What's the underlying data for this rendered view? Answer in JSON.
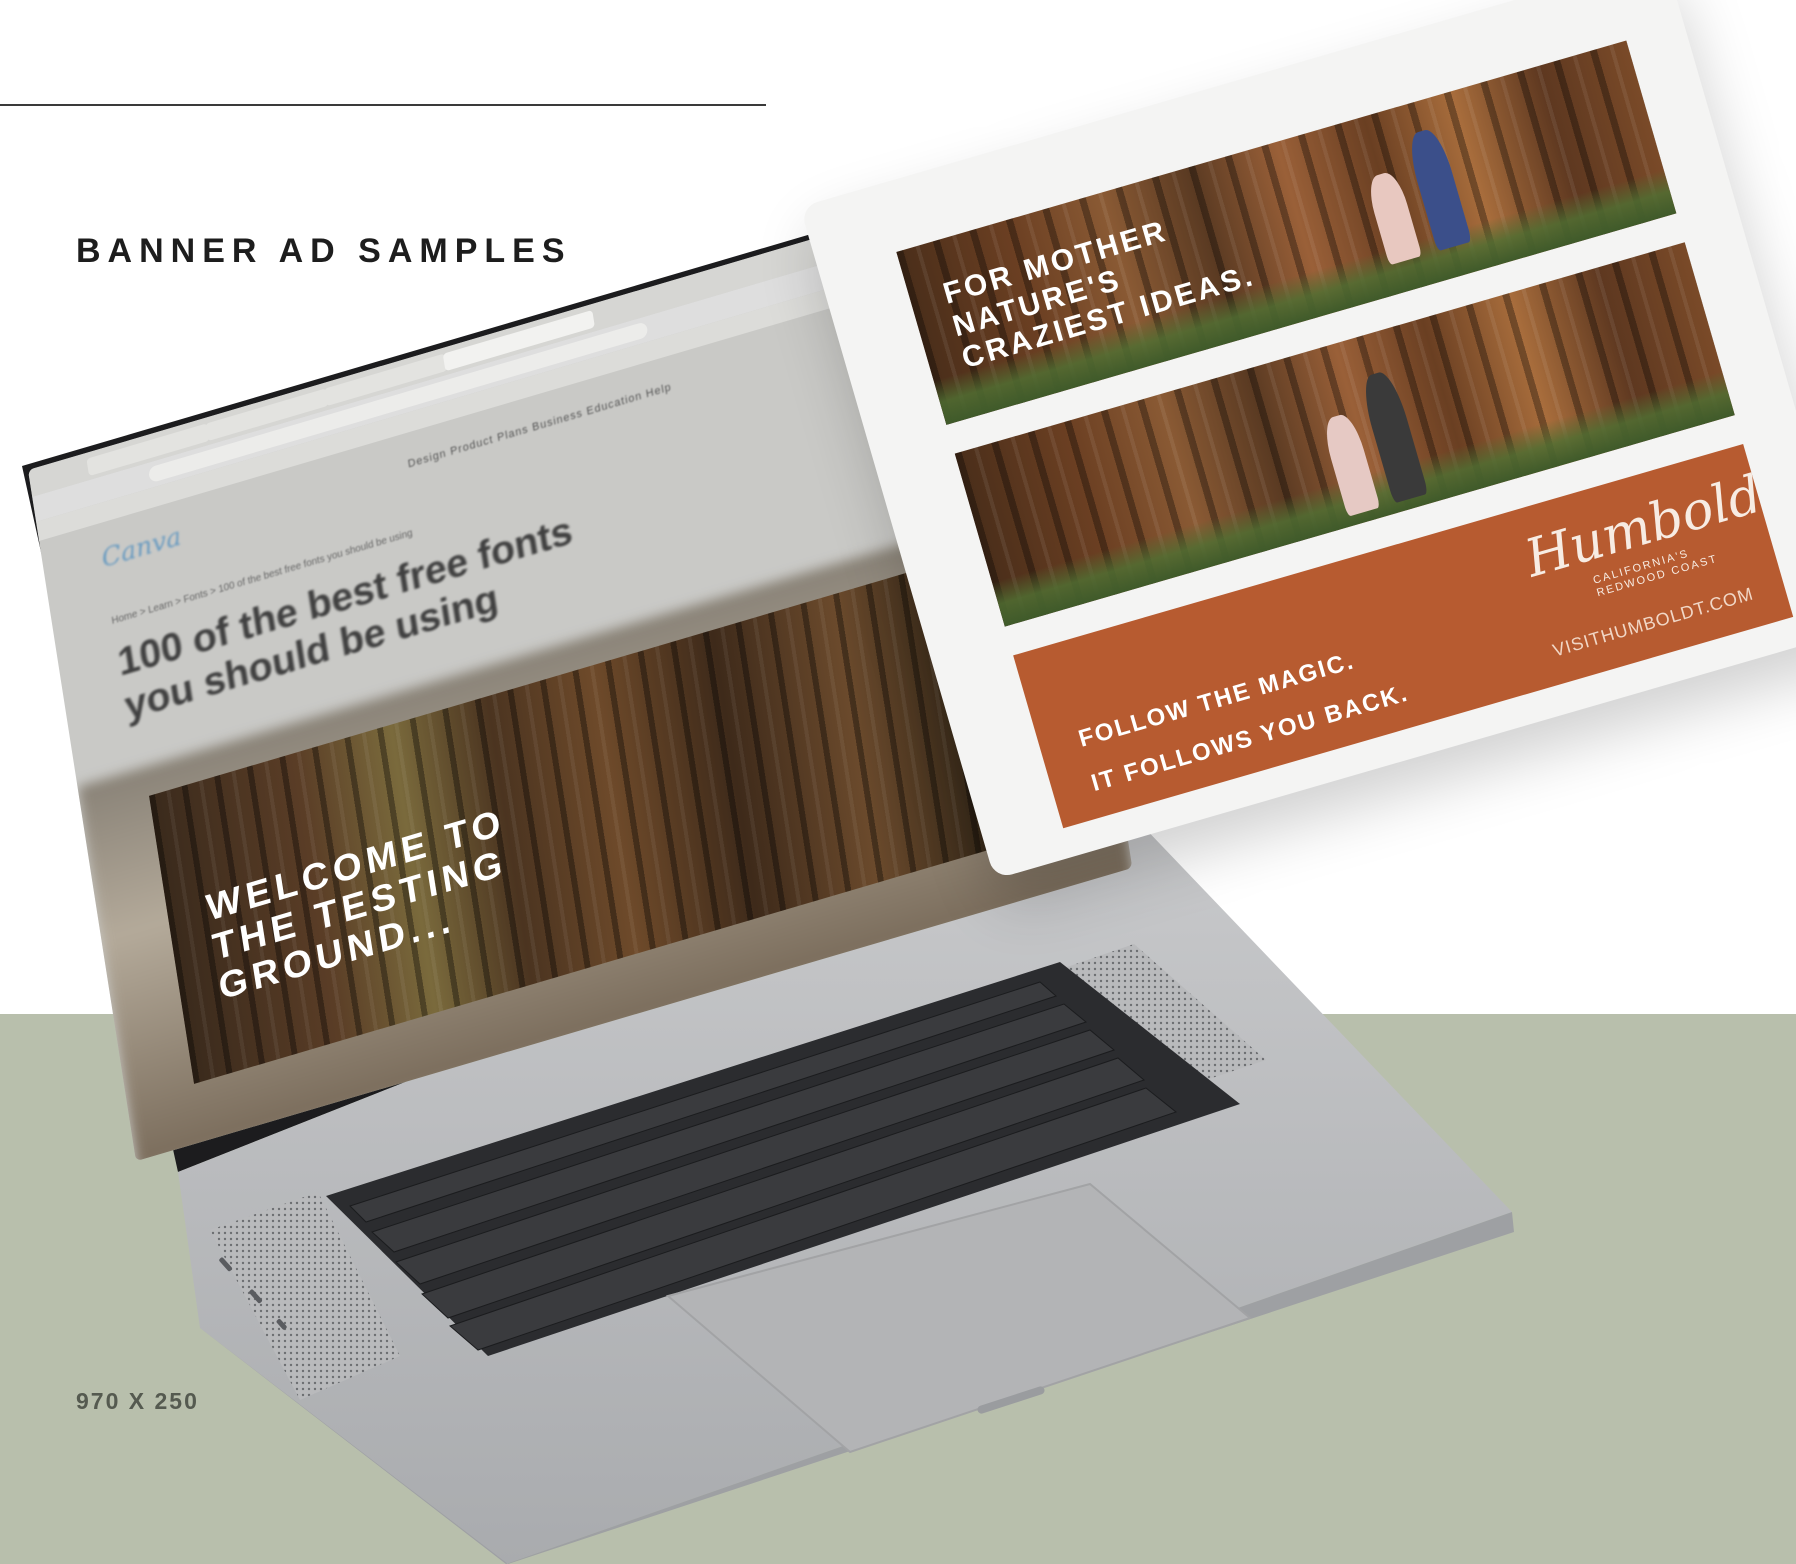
{
  "page": {
    "headline": "BANNER AD SAMPLES",
    "size_caption": "970 X 250",
    "colors": {
      "band": "#b8bfac",
      "ad_orange": "#b75b30",
      "text_dark": "#1d1d1d"
    }
  },
  "laptop_screen": {
    "site_logo": "Canva",
    "nav": "Design   Product   Plans   Business   Education   Help",
    "breadcrumb": "Home  >  Learn  >  Fonts  >  100 of the best free fonts you should be using",
    "article_title": "100 of the best free fonts you should be using",
    "banner_text_lines": [
      "WELCOME TO",
      "THE TESTING",
      "GROUND..."
    ]
  },
  "card": {
    "ad1_headline_lines": [
      "FOR MOTHER",
      "NATURE'S",
      "CRAZIEST IDEAS."
    ],
    "ad3_tagline_1": "FOLLOW THE MAGIC.",
    "ad3_tagline_2": "IT FOLLOWS YOU BACK.",
    "logo_script": "Humboldt",
    "logo_sub_1": "CALIFORNIA'S",
    "logo_sub_2": "REDWOOD COAST",
    "logo_url": "VISITHUMBOLDT.COM"
  },
  "icons": {
    "laptop": "laptop-icon",
    "keyboard": "keyboard-icon",
    "trackpad": "trackpad-icon"
  }
}
